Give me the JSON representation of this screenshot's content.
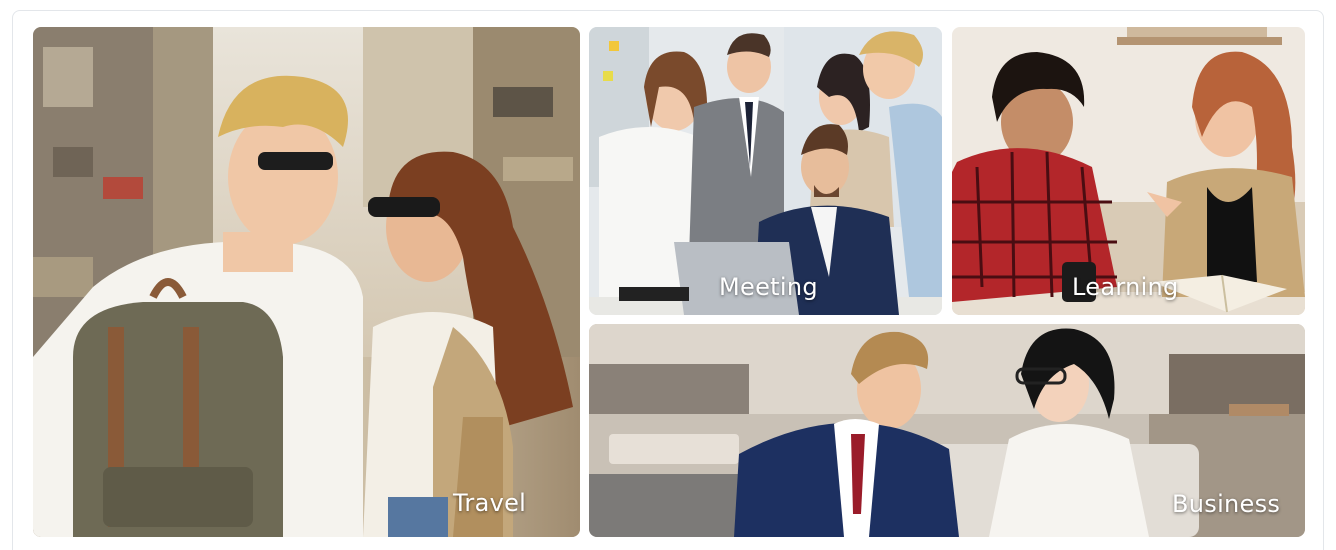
{
  "cards": [
    {
      "id": "travel",
      "label": "Travel"
    },
    {
      "id": "meeting",
      "label": "Meeting"
    },
    {
      "id": "learning",
      "label": "Learning"
    },
    {
      "id": "business",
      "label": "Business"
    }
  ],
  "colors": {
    "label_text": "#ffffff",
    "frame_border": "#e3e6ea"
  }
}
